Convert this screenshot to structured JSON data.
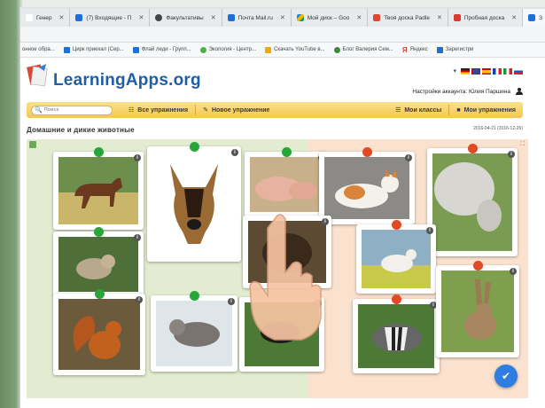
{
  "browser": {
    "tabs": [
      {
        "label": "Генер",
        "color": "#ffffff",
        "active": false
      },
      {
        "label": "(7) Входящие - П",
        "color": "#1e6fd9",
        "active": false
      },
      {
        "label": "Факультативы",
        "color": "#444444",
        "active": false
      },
      {
        "label": "Почта Mail.ru",
        "color": "#1e6fd9",
        "active": false
      },
      {
        "label": "Мой диск – Goo",
        "color": "#f4b400",
        "active": false
      },
      {
        "label": "Твоя доска Padle",
        "color": "#e2452f",
        "active": false
      },
      {
        "label": "Пробная доска",
        "color": "#d63b2e",
        "active": false
      },
      {
        "label": "З",
        "color": "#1e6fd9",
        "active": true
      }
    ],
    "bookmarks": [
      {
        "label": "онное обра...",
        "color": "#ffffff"
      },
      {
        "label": "Цирк приехал (Сер...",
        "color": "#1e6fd9"
      },
      {
        "label": "Флай леди - Групп...",
        "color": "#1e6fd9"
      },
      {
        "label": "Экология - Центр...",
        "color": "#4caf50"
      },
      {
        "label": "Скачать YouTube в...",
        "color": "#f2a900"
      },
      {
        "label": "Блог Валерия Сем...",
        "color": "#3a8a3a"
      },
      {
        "label": "Яндекс",
        "color": "#e03a2a"
      },
      {
        "label": "Зарегистри",
        "color": "#1e6fd9"
      }
    ]
  },
  "site": {
    "logo": "LearningApps.org",
    "account_label": "Настройки аккаунта: Юлия Паршина",
    "search_placeholder": "Поиск",
    "nav": {
      "all_exercises": "Все упражнения",
      "new_exercise": "Новое упражнение",
      "my_classes": "Мои классы",
      "my_exercises": "Мои упражнения"
    },
    "exercise_title": "Домашние и дикие животные",
    "date": "2016-04-21 (2016-12-26)"
  },
  "colors": {
    "accent": "#1e5fa8",
    "nav_bg": "#f3c850",
    "green_marker": "#2aa53a",
    "red_marker": "#e04a26",
    "fab": "#2d7ee0"
  },
  "cards": [
    {
      "animal": "horse",
      "marker": "green"
    },
    {
      "animal": "german-shepherd",
      "marker": "green"
    },
    {
      "animal": "pig",
      "marker": "green"
    },
    {
      "animal": "cat",
      "marker": "red"
    },
    {
      "animal": "sheep",
      "marker": "red"
    },
    {
      "animal": "lynx",
      "marker": "green"
    },
    {
      "animal": "bear",
      "marker": "none"
    },
    {
      "animal": "goat",
      "marker": "red"
    },
    {
      "animal": "squirrel",
      "marker": "green"
    },
    {
      "animal": "wolf",
      "marker": "green"
    },
    {
      "animal": "calf",
      "marker": "none"
    },
    {
      "animal": "badger",
      "marker": "red"
    },
    {
      "animal": "hare",
      "marker": "red"
    }
  ]
}
